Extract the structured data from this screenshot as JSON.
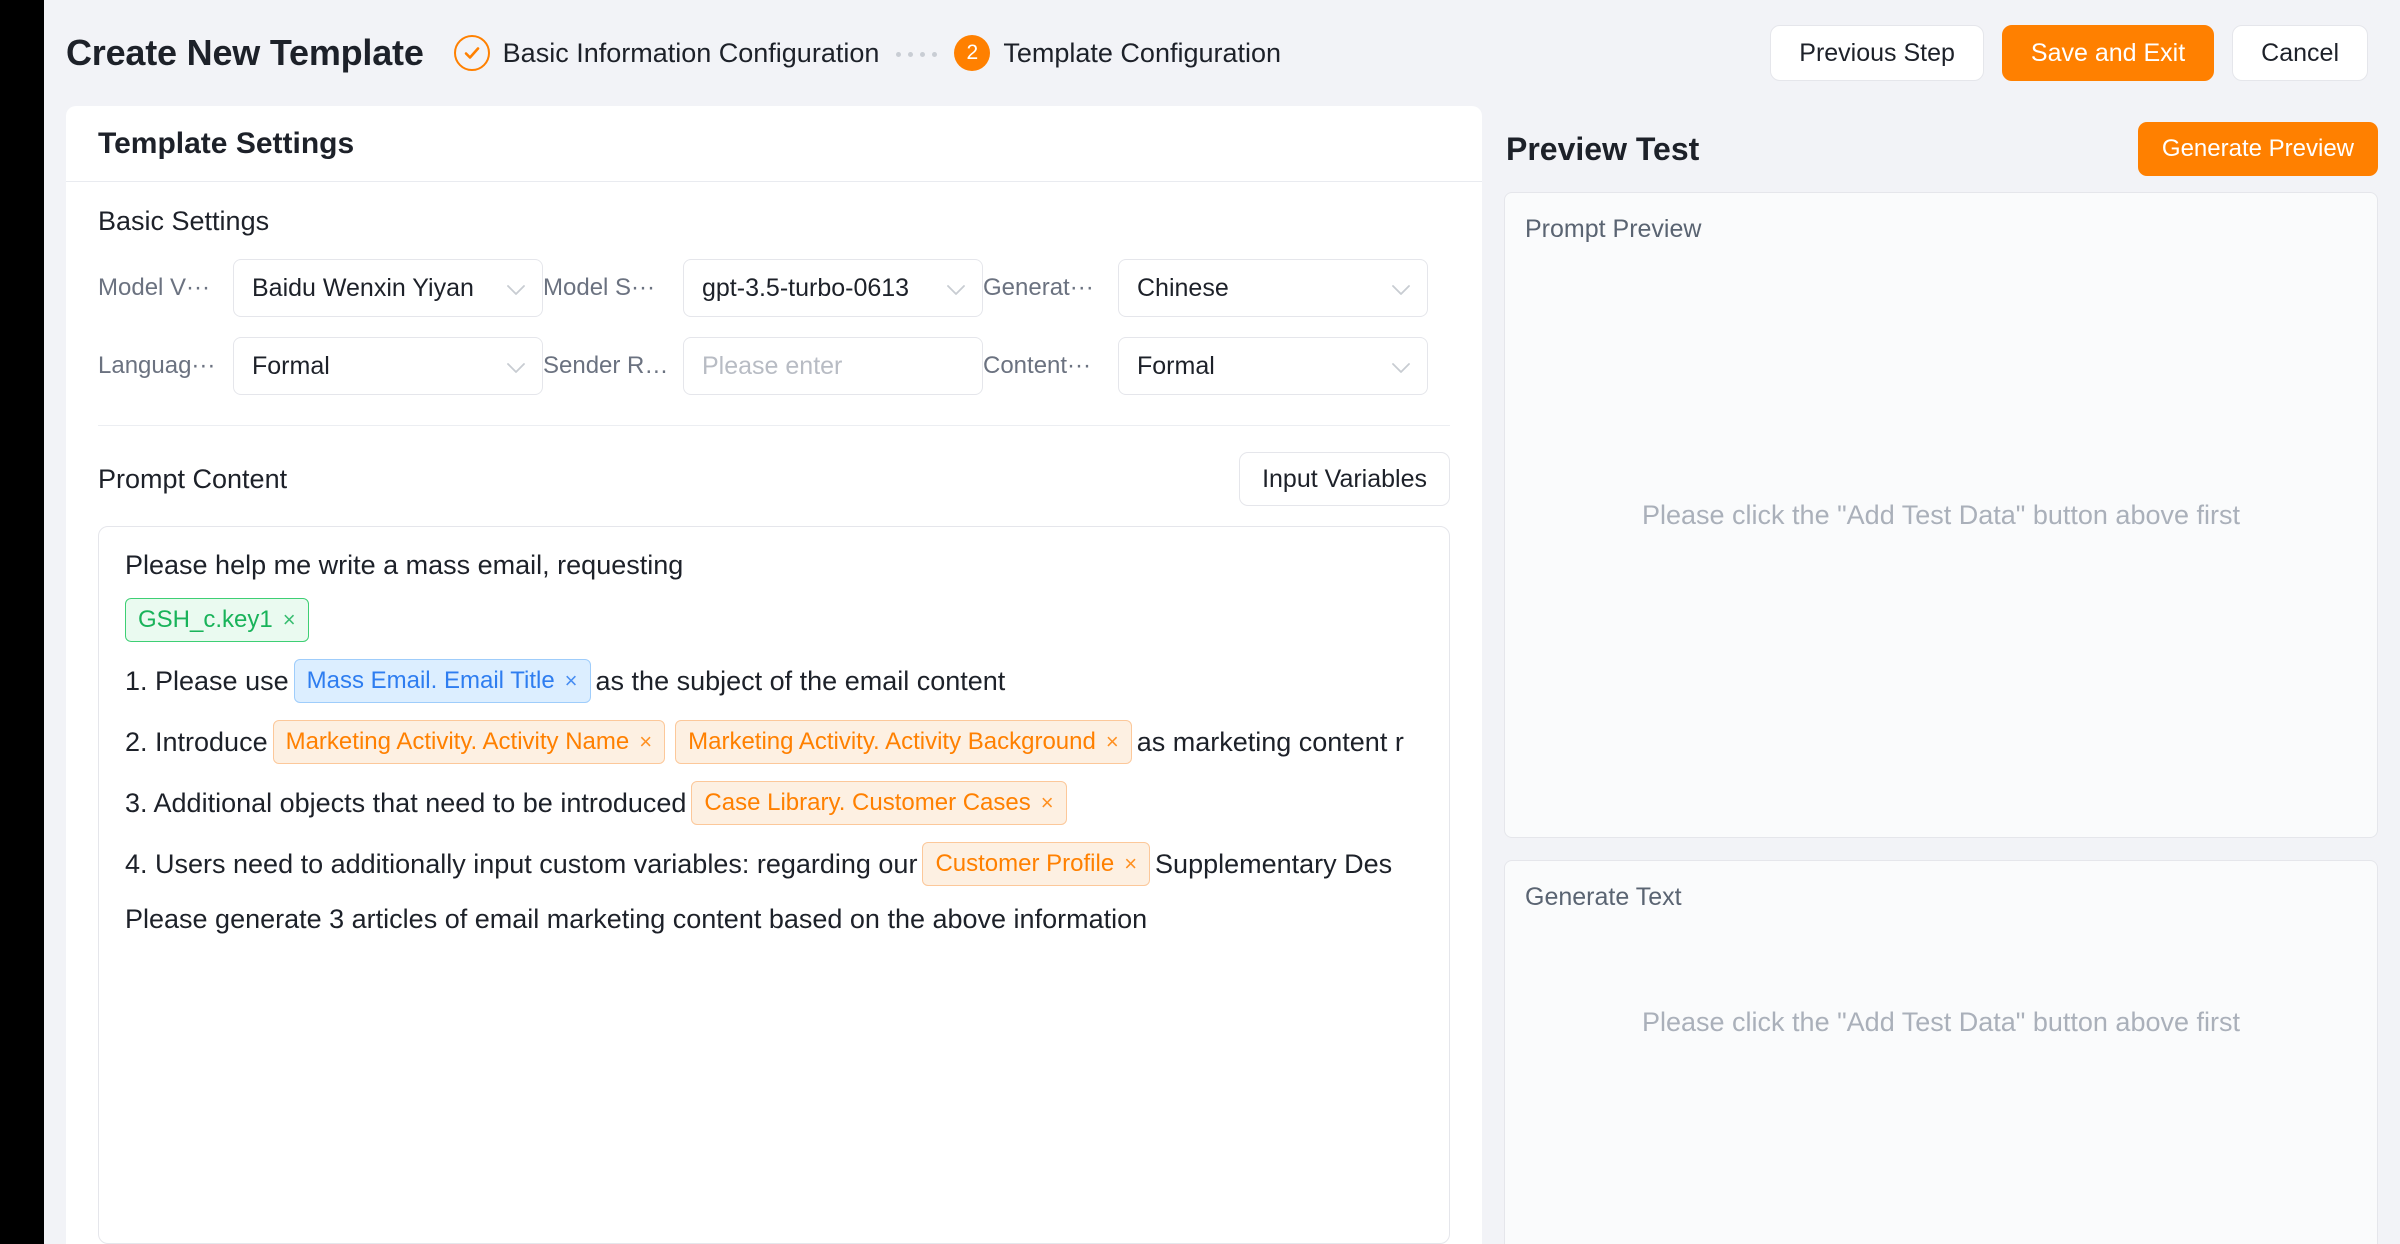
{
  "header": {
    "title": "Create New Template",
    "steps": [
      {
        "label": "Basic Information Configuration",
        "state": "done",
        "number": ""
      },
      {
        "label": "Template Configuration",
        "state": "active",
        "number": "2"
      }
    ],
    "actions": {
      "previous": "Previous Step",
      "save": "Save and Exit",
      "cancel": "Cancel"
    }
  },
  "settings": {
    "card_title": "Template Settings",
    "basic_title": "Basic Settings",
    "fields": {
      "model_vendor_label": "Model V···",
      "model_vendor_value": "Baidu Wenxin Yiyan",
      "model_series_label": "Model S···",
      "model_series_value": "gpt-3.5-turbo-0613",
      "generate_lang_label": "Generat···",
      "generate_lang_value": "Chinese",
      "language_style_label": "Languag···",
      "language_style_value": "Formal",
      "sender_role_label": "Sender Role",
      "sender_role_value": "",
      "sender_role_placeholder": "Please enter",
      "content_style_label": "Content···",
      "content_style_value": "Formal"
    }
  },
  "prompt": {
    "title": "Prompt Content",
    "input_variables_button": "Input Variables",
    "lines": [
      {
        "id": "intro",
        "parts": [
          {
            "type": "text",
            "value": "Please help me write a mass email, requesting"
          }
        ]
      },
      {
        "id": "tag-line",
        "parts": [
          {
            "type": "tag",
            "value": "GSH_c.key1",
            "color": "green"
          }
        ]
      },
      {
        "id": "item-1",
        "parts": [
          {
            "type": "text",
            "value": "1. Please use"
          },
          {
            "type": "tag",
            "value": "Mass Email. Email Title",
            "color": "blue"
          },
          {
            "type": "text",
            "value": "as the subject of the email content"
          }
        ]
      },
      {
        "id": "item-2",
        "parts": [
          {
            "type": "text",
            "value": "2. Introduce"
          },
          {
            "type": "tag",
            "value": "Marketing Activity. Activity Name",
            "color": "orange"
          },
          {
            "type": "tag",
            "value": "Marketing Activity. Activity Background",
            "color": "orange"
          },
          {
            "type": "text",
            "value": "as marketing content r"
          }
        ]
      },
      {
        "id": "item-3",
        "parts": [
          {
            "type": "text",
            "value": "3. Additional objects that need to be introduced"
          },
          {
            "type": "tag",
            "value": "Case Library. Customer Cases",
            "color": "orange"
          }
        ]
      },
      {
        "id": "item-4",
        "parts": [
          {
            "type": "text",
            "value": "4. Users need to additionally input custom variables: regarding our"
          },
          {
            "type": "tag",
            "value": "Customer Profile",
            "color": "orange"
          },
          {
            "type": "text",
            "value": "Supplementary Des"
          }
        ]
      },
      {
        "id": "closing",
        "parts": [
          {
            "type": "text",
            "value": "Please generate 3 articles of email marketing content based on the above information"
          }
        ]
      }
    ]
  },
  "preview": {
    "title": "Preview Test",
    "generate_button": "Generate Preview",
    "prompt_preview_label": "Prompt Preview",
    "prompt_preview_empty": "Please click the \"Add Test Data\" button above first",
    "generate_text_label": "Generate Text",
    "generate_text_empty": "Please click the \"Add Test Data\" button above first"
  },
  "colors": {
    "accent": "#ff8000",
    "tag_green": "#19b35a",
    "tag_blue": "#2e7df0",
    "tag_orange": "#ff8000",
    "page_bg": "#f2f3f7"
  },
  "icons": {
    "check": "check-icon",
    "chevron_down": "chevron-down-icon",
    "close": "close-icon"
  }
}
